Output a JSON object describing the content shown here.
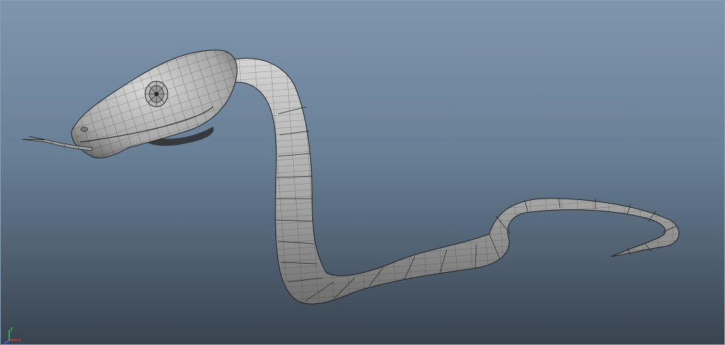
{
  "viewport": {
    "background_top": "#7e96ad",
    "background_bottom": "#38434f",
    "display_mode": "wireframe-on-shaded",
    "subject": "snake-model"
  },
  "axis_gizmo": {
    "x_label": "x",
    "y_label": "y",
    "z_label": "z",
    "x_color": "#e23c3c",
    "y_color": "#3ed24a",
    "z_color": "#3c6cff"
  }
}
